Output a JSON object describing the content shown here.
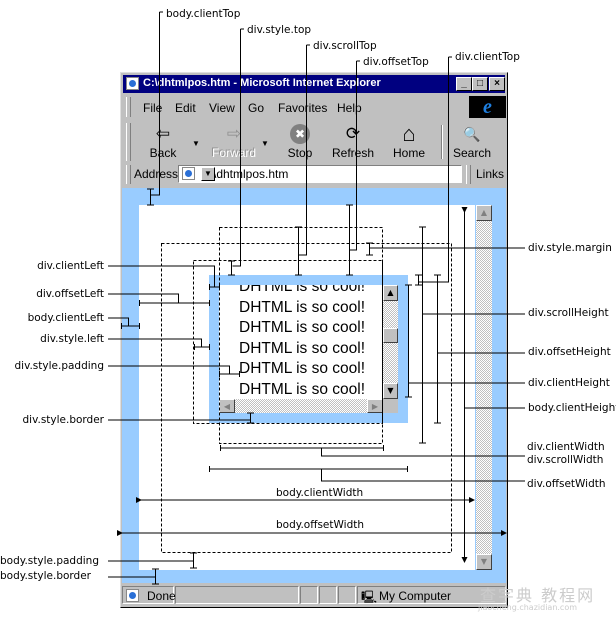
{
  "window": {
    "title": "C:\\dhtmlpos.htm - Microsoft Internet Explorer",
    "controls": [
      "_",
      "□",
      "×"
    ]
  },
  "menu": {
    "items": [
      {
        "label": "File",
        "accel": "F"
      },
      {
        "label": "Edit",
        "accel": "E"
      },
      {
        "label": "View",
        "accel": "V"
      },
      {
        "label": "Go",
        "accel": "G"
      },
      {
        "label": "Favorites",
        "accel": "a"
      },
      {
        "label": "Help",
        "accel": "H"
      }
    ],
    "logo": "e"
  },
  "toolbar": {
    "buttons": [
      {
        "label": "Back",
        "icon": "back-arrow-icon",
        "glyph": "⇦",
        "enabled": true
      },
      {
        "label": "Forward",
        "icon": "forward-arrow-icon",
        "glyph": "⇨",
        "enabled": false
      },
      {
        "label": "Stop",
        "icon": "stop-icon",
        "glyph": "✖",
        "enabled": true
      },
      {
        "label": "Refresh",
        "icon": "refresh-icon",
        "glyph": "⟳",
        "enabled": true
      },
      {
        "label": "Home",
        "icon": "home-icon",
        "glyph": "⌂",
        "enabled": true
      },
      {
        "label": "Search",
        "icon": "search-icon",
        "glyph": "🔍",
        "enabled": true
      }
    ]
  },
  "address": {
    "label": "Address",
    "value": "C:\\dhtmlpos.htm",
    "links_label": "Links"
  },
  "content": {
    "div_text": "DHTML is so cool! DHTML is so cool! DHTML is so cool! DHTML is so cool! DHTML is so cool! DHTML is so cool!",
    "colors": {
      "border": "#99ccff",
      "background": "#ffffff",
      "chrome": "#c0c0c0",
      "titlebar": "#000080"
    }
  },
  "status": {
    "text": "Done",
    "zone": "My Computer"
  },
  "annotations": {
    "top": [
      "body.clientTop",
      "div.style.top",
      "div.scrollTop",
      "div.offsetTop",
      "div.clientTop"
    ],
    "left": [
      "div.clientLeft",
      "div.offsetLeft",
      "body.clientLeft",
      "div.style.left",
      "div.style.padding",
      "div.style.border",
      "body.style.padding",
      "body.style.border"
    ],
    "right": [
      "div.style.margin",
      "div.scrollHeight",
      "div.offsetHeight",
      "div.clientHeight",
      "body.clientHeight",
      "div.clientWidth",
      "div.scrollWidth",
      "div.offsetWidth"
    ],
    "center": [
      "body.clientWidth",
      "body.offsetWidth"
    ]
  },
  "watermark": {
    "text": "查字典 教程网",
    "url_text": "jiaocheng.chazidian.com"
  }
}
